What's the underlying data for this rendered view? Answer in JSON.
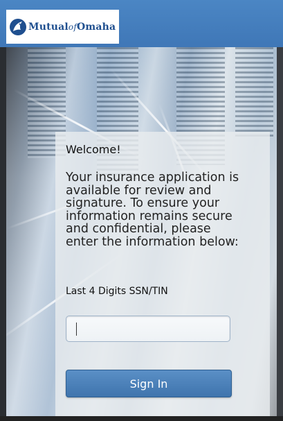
{
  "header": {
    "logo_word_1": "Mutual",
    "logo_word_of": "of",
    "logo_word_2": "Omaha",
    "logo_icon": "indian-head-icon",
    "bar_color": "#4580bf"
  },
  "form": {
    "welcome": "Welcome!",
    "intro": "Your insurance application is available for review and signature. To ensure your information remains secure and confidential, please enter the information below:",
    "field_label": "Last 4 Digits SSN/TIN",
    "field_value": "",
    "sign_in_label": "Sign In",
    "button_color": "#4a80ba"
  }
}
